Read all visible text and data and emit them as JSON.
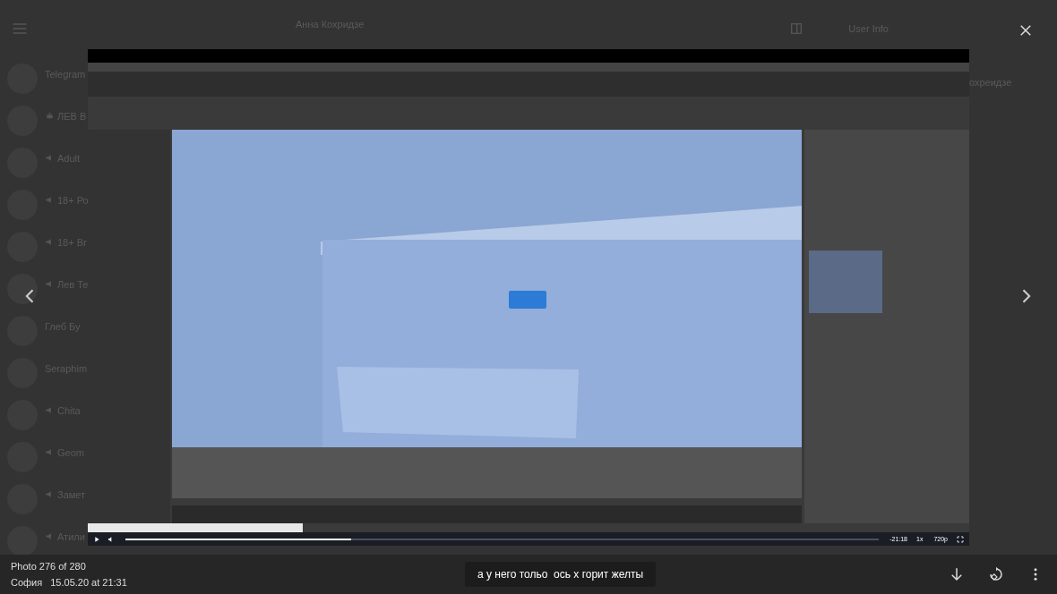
{
  "background": {
    "chat_title": "Анна Кохридзе",
    "info_title": "User Info",
    "side_name": "охреидзе",
    "chats": [
      {
        "name": "Telegram",
        "kind": "user"
      },
      {
        "name": "ЛЕВ В",
        "kind": "bot"
      },
      {
        "name": "Adult",
        "kind": "channel"
      },
      {
        "name": "18+ Ро",
        "kind": "channel"
      },
      {
        "name": "18+ Вг",
        "kind": "channel"
      },
      {
        "name": "Лев Те",
        "kind": "channel"
      },
      {
        "name": "Глеб Бу",
        "kind": "user"
      },
      {
        "name": "Seraphim",
        "kind": "user"
      },
      {
        "name": "Chita",
        "kind": "channel"
      },
      {
        "name": "Geom",
        "kind": "channel"
      },
      {
        "name": "Замет",
        "kind": "channel"
      },
      {
        "name": "Атили",
        "kind": "channel"
      }
    ]
  },
  "viewer": {
    "video": {
      "kind": "picture",
      "level": 0.3,
      "remaining": "-21:18",
      "speed": "1x",
      "quality": "720p"
    },
    "counter": "Photo 276 of 280",
    "author": "София",
    "date": "15.05.20 at 21:31",
    "caption": "а у него тольо  ось х горит желты"
  }
}
